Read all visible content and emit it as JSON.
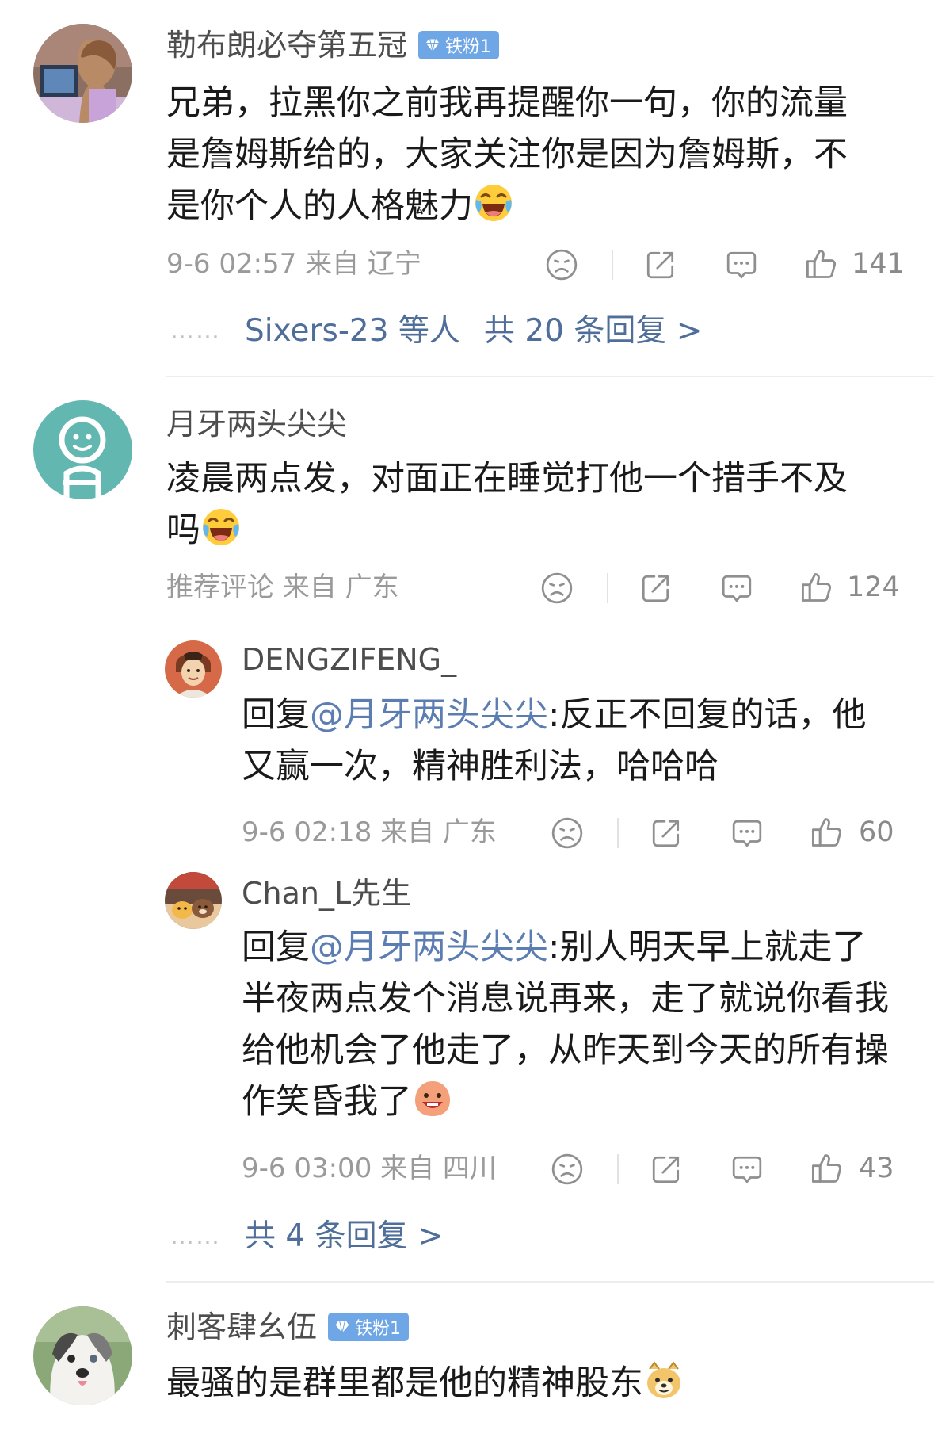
{
  "comments": [
    {
      "username": "勒布朗必夺第五冠",
      "badge": "铁粉1",
      "text": "兄弟，拉黑你之前我再提醒你一句，你的流量是詹姆斯给的，大家关注你是因为詹姆斯，不是你个人的人格魅力",
      "meta": "9-6 02:57 来自 辽宁",
      "likes": "141",
      "replies_preview": {
        "users": "Sixers-23 等人",
        "summary": "共 20 条回复 >"
      }
    },
    {
      "username": "月牙两头尖尖",
      "text": "凌晨两点发，对面正在睡觉打他一个措手不及吗",
      "meta": "推荐评论 来自 广东",
      "likes": "124",
      "replies": [
        {
          "username": "DENGZIFENG_",
          "reply_prefix": "回复",
          "mention": "@月牙两头尖尖",
          "text": ":反正不回复的话，他又赢一次，精神胜利法，哈哈哈",
          "meta": "9-6 02:18 来自 广东",
          "likes": "60"
        },
        {
          "username": "Chan_L先生",
          "reply_prefix": "回复",
          "mention": "@月牙两头尖尖",
          "text": ":别人明天早上就走了半夜两点发个消息说再来，走了就说你看我给他机会了他走了，从昨天到今天的所有操作笑昏我了",
          "meta": "9-6 03:00 来自 四川",
          "likes": "43"
        }
      ],
      "replies_summary": "共 4 条回复 >"
    },
    {
      "username": "刺客肆幺伍",
      "badge": "铁粉1",
      "text": "最骚的是群里都是他的精神股东"
    }
  ],
  "icons": {
    "emotion": "sad-face-icon",
    "share": "share-icon",
    "comment": "comment-icon",
    "like": "thumbs-up-icon"
  },
  "colors": {
    "link": "#4f6e99",
    "badge": "#6ea6e6",
    "meta": "#9a9a9a"
  }
}
